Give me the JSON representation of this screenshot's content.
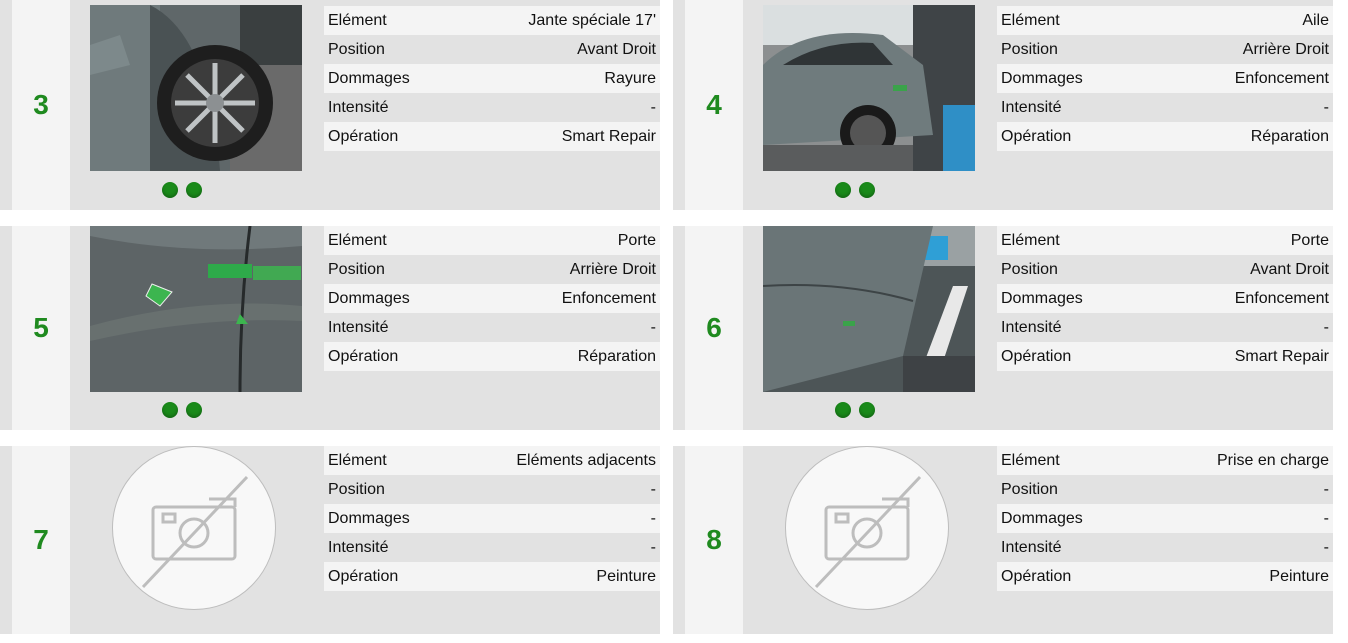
{
  "colors": {
    "number": "#1f8a1f",
    "dot": "#1a8a1a",
    "card_bg": "#e2e2e2",
    "row_light": "#f4f4f4"
  },
  "damages": [
    {
      "number": "3",
      "photo": "car-wheel-photo",
      "rows": [
        {
          "label": "Elément",
          "value": "Jante spéciale 17'"
        },
        {
          "label": "Position",
          "value": "Avant Droit"
        },
        {
          "label": "Dommages",
          "value": "Rayure"
        },
        {
          "label": "Intensité",
          "value": "-"
        },
        {
          "label": "Opération",
          "value": "Smart Repair"
        }
      ]
    },
    {
      "number": "4",
      "photo": "car-rear-photo",
      "rows": [
        {
          "label": "Elément",
          "value": "Aile"
        },
        {
          "label": "Position",
          "value": "Arrière Droit"
        },
        {
          "label": "Dommages",
          "value": "Enfoncement"
        },
        {
          "label": "Intensité",
          "value": "-"
        },
        {
          "label": "Opération",
          "value": "Réparation"
        }
      ]
    },
    {
      "number": "5",
      "photo": "car-door-closeup-photo",
      "rows": [
        {
          "label": "Elément",
          "value": "Porte"
        },
        {
          "label": "Position",
          "value": "Arrière Droit"
        },
        {
          "label": "Dommages",
          "value": "Enfoncement"
        },
        {
          "label": "Intensité",
          "value": "-"
        },
        {
          "label": "Opération",
          "value": "Réparation"
        }
      ]
    },
    {
      "number": "6",
      "photo": "car-side-photo",
      "rows": [
        {
          "label": "Elément",
          "value": "Porte"
        },
        {
          "label": "Position",
          "value": "Avant Droit"
        },
        {
          "label": "Dommages",
          "value": "Enfoncement"
        },
        {
          "label": "Intensité",
          "value": "-"
        },
        {
          "label": "Opération",
          "value": "Smart Repair"
        }
      ]
    },
    {
      "number": "7",
      "photo": "no-photo-icon",
      "rows": [
        {
          "label": "Elément",
          "value": "Eléments adjacents"
        },
        {
          "label": "Position",
          "value": "-"
        },
        {
          "label": "Dommages",
          "value": "-"
        },
        {
          "label": "Intensité",
          "value": "-"
        },
        {
          "label": "Opération",
          "value": "Peinture"
        }
      ]
    },
    {
      "number": "8",
      "photo": "no-photo-icon",
      "rows": [
        {
          "label": "Elément",
          "value": "Prise en charge"
        },
        {
          "label": "Position",
          "value": "-"
        },
        {
          "label": "Dommages",
          "value": "-"
        },
        {
          "label": "Intensité",
          "value": "-"
        },
        {
          "label": "Opération",
          "value": "Peinture"
        }
      ]
    }
  ]
}
